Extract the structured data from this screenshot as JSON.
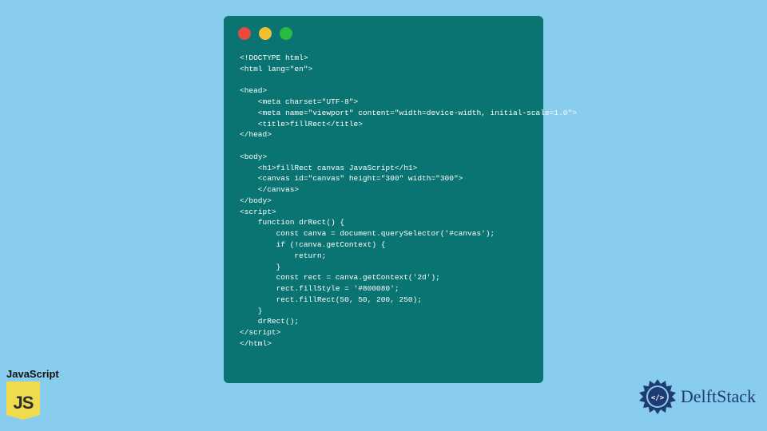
{
  "code_window": {
    "lines": [
      "<!DOCTYPE html>",
      "<html lang=\"en\">",
      "",
      "<head>",
      "    <meta charset=\"UTF-8\">",
      "    <meta name=\"viewport\" content=\"width=device-width, initial-scale=1.0\">",
      "    <title>fillRect</title>",
      "</head>",
      "",
      "<body>",
      "    <h1>fillRect canvas JavaScript</h1>",
      "    <canvas id=\"canvas\" height=\"300\" width=\"300\">",
      "    </canvas>",
      "</body>",
      "<script>",
      "    function drRect() {",
      "        const canva = document.querySelector('#canvas');",
      "        if (!canva.getContext) {",
      "            return;",
      "        }",
      "        const rect = canva.getContext('2d');",
      "        rect.fillStyle = '#800080';",
      "        rect.fillRect(50, 50, 200, 250);",
      "    }",
      "    drRect();",
      "</script>",
      "</html>"
    ]
  },
  "js_badge": {
    "label": "JavaScript",
    "icon_text": "JS"
  },
  "delft_logo": {
    "text": "DelftStack"
  },
  "colors": {
    "background": "#88ccee",
    "window_bg": "#097472",
    "code_text": "#ffffff",
    "js_yellow": "#f0db4e",
    "delft_blue": "#203a72",
    "tl_red": "#e84c3d",
    "tl_yellow": "#f0c030",
    "tl_green": "#28bd41"
  }
}
